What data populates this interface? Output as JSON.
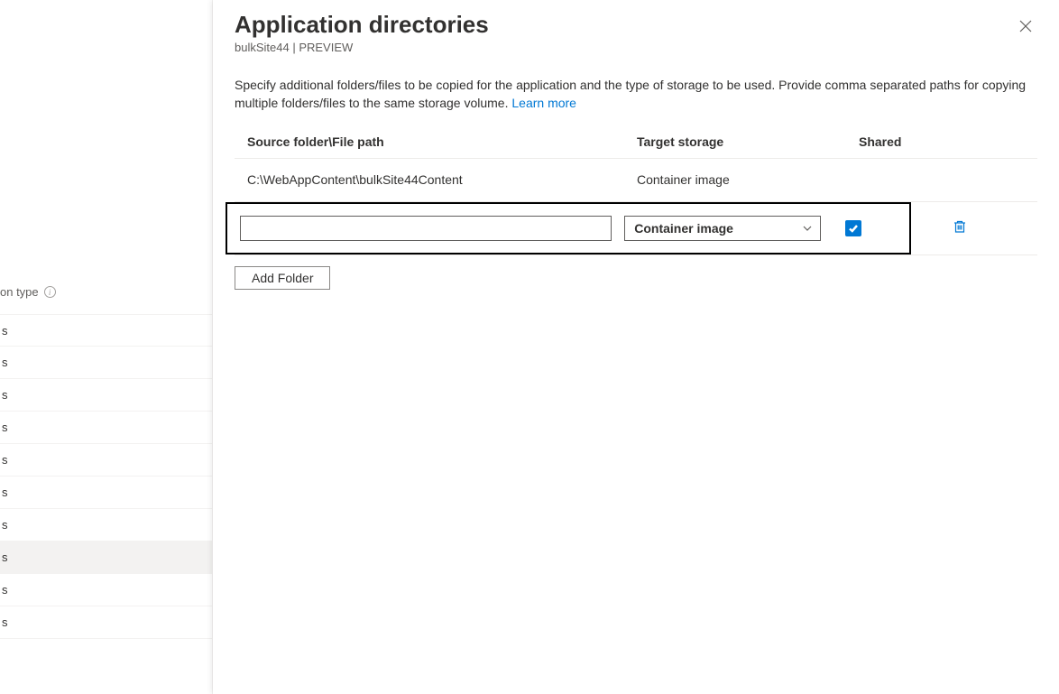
{
  "panel": {
    "title": "Application directories",
    "subtitle_resource": "bulkSite44",
    "subtitle_preview": "PREVIEW",
    "subtitle_separator": " | ",
    "description": "Specify additional folders/files to be copied for the application and the type of storage to be used. Provide comma separated paths for copying multiple folders/files to the same storage volume. ",
    "learn_more": "Learn more"
  },
  "table": {
    "headers": {
      "source": "Source folder\\File path",
      "target": "Target storage",
      "shared": "Shared"
    },
    "rows": [
      {
        "source": "C:\\WebAppContent\\bulkSite44Content",
        "target": "Container image",
        "shared": false
      }
    ],
    "edit_row": {
      "source_value": "",
      "target_selected": "Container image",
      "shared_checked": true
    }
  },
  "buttons": {
    "add_folder": "Add Folder"
  },
  "background": {
    "list_header": "on type",
    "items": [
      {
        "label": "s",
        "selected": false
      },
      {
        "label": "s",
        "selected": false
      },
      {
        "label": "s",
        "selected": false
      },
      {
        "label": "s",
        "selected": false
      },
      {
        "label": "s",
        "selected": false
      },
      {
        "label": "s",
        "selected": false
      },
      {
        "label": "s",
        "selected": false
      },
      {
        "label": "s",
        "selected": true
      },
      {
        "label": "s",
        "selected": false
      },
      {
        "label": "s",
        "selected": false
      }
    ]
  },
  "icons": {
    "close": "close-icon",
    "info": "info-icon",
    "chevron_down": "chevron-down-icon",
    "check": "check-icon",
    "trash": "trash-icon"
  }
}
